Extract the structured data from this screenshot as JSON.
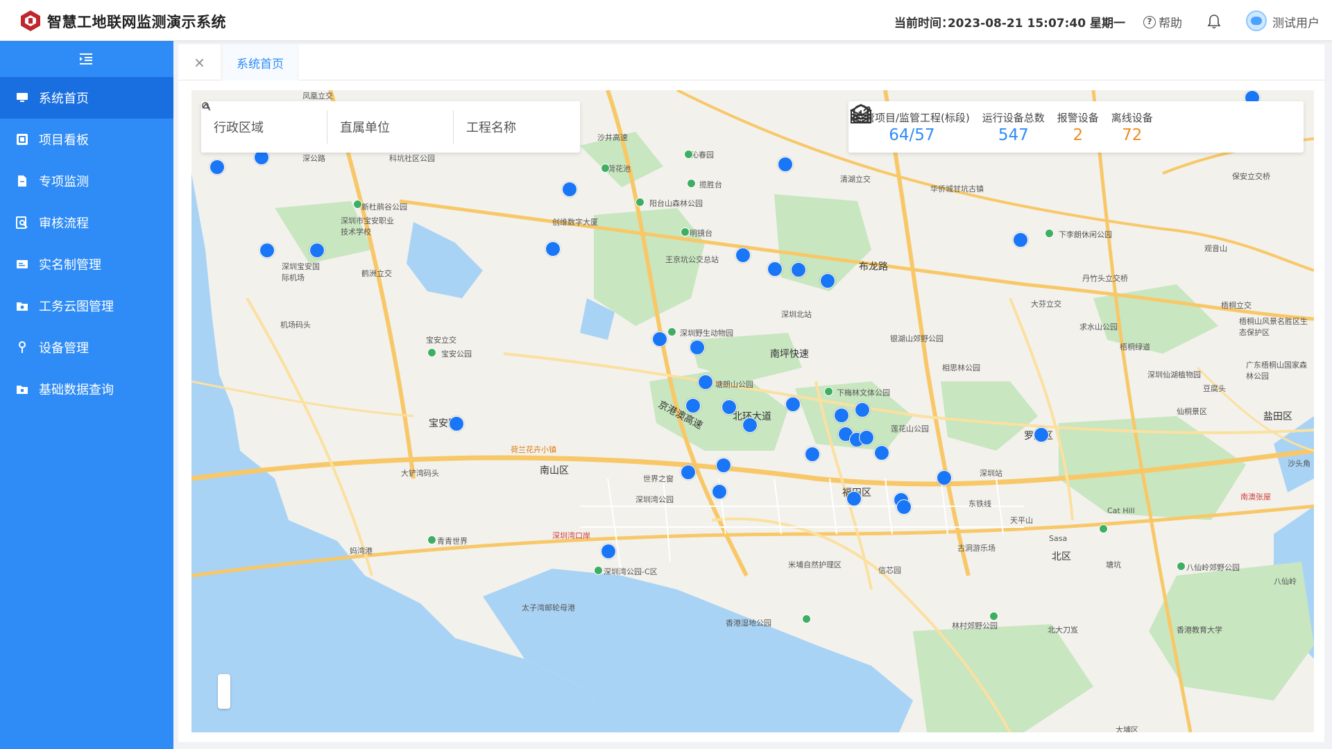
{
  "app": {
    "title": "智慧工地联网监测演示系统"
  },
  "header": {
    "time_label": "当前时间：",
    "time_value": "2023-08-21 15:07:40 星期一",
    "help_label": "帮助",
    "user_name": "测试用户"
  },
  "sidebar": {
    "items": [
      {
        "label": "系统首页",
        "icon": "monitor-icon",
        "active": true
      },
      {
        "label": "项目看板",
        "icon": "board-icon"
      },
      {
        "label": "专项监测",
        "icon": "document-icon"
      },
      {
        "label": "审核流程",
        "icon": "search-doc-icon"
      },
      {
        "label": "实名制管理",
        "icon": "id-card-icon"
      },
      {
        "label": "工务云图管理",
        "icon": "folder-icon"
      },
      {
        "label": "设备管理",
        "icon": "pin-icon"
      },
      {
        "label": "基础数据查询",
        "icon": "folder-data-icon"
      }
    ]
  },
  "tabs": [
    {
      "label": "系统首页",
      "active": true
    }
  ],
  "filters": {
    "district": "行政区域",
    "unit": "直属单位",
    "project": "工程名称"
  },
  "stats": {
    "projects": {
      "label": "监管项目/监管工程(标段)",
      "value": "64/57",
      "color": "#2f8cf6"
    },
    "devices": {
      "label": "运行设备总数",
      "value": "547",
      "color": "#2f8cf6"
    },
    "alarm": {
      "label": "报警设备",
      "value": "2",
      "color": "#f08c1e"
    },
    "offline": {
      "label": "离线设备",
      "value": "72",
      "color": "#f08c1e"
    }
  },
  "map_labels": [
    "凤凰立交",
    "深公路",
    "科坑社区公园",
    "沙井高速",
    "沁春园",
    "荷花池",
    "揽胜台",
    "阳台山森林公园",
    "清湖立交",
    "华侨城甘坑古镇",
    "下李朗休闲公园",
    "保安立交桥",
    "新杜鹃谷公园",
    "深圳市宝安职业技术学校",
    "创维数字大厦",
    "明镜台",
    "王京坑公交总站",
    "布龙路",
    "丹竹头立交桥",
    "观音山",
    "深圳宝安国际机场",
    "鹤洲立交",
    "深圳北站",
    "大芬立交",
    "梧桐立交",
    "机场码头",
    "深圳野生动物园",
    "南坪快速",
    "银湖山郊野公园",
    "求水山公园",
    "梧桐绿道",
    "梧桐山风景名胜区生态保护区",
    "宝安立交",
    "宝安公园",
    "相思林公园",
    "深圳仙湖植物园",
    "广东梧桐山国家森林公园",
    "塘朗山公园",
    "下梅林文体公园",
    "豆腐头",
    "仙桐景区",
    "盐田区",
    "宝安区",
    "京港澳高速",
    "北环大道",
    "莲花山公园",
    "罗湖区",
    "荷兰花卉小镇",
    "大铲湾码头",
    "南山区",
    "世界之窗",
    "深圳站",
    "沙头角",
    "南澳张屋",
    "深圳湾公园",
    "福田区",
    "东铁线",
    "天平山",
    "Cat Hill",
    "深圳湾口岸",
    "青青世界",
    "Sasa",
    "古洞游乐场",
    "北区",
    "塘坑",
    "八仙岭郊野公园",
    "八仙岭",
    "妈湾港",
    "米埔自然护理区",
    "信芯园",
    "深圳湾公园-C区",
    "太子湾邮轮母港",
    "香港湿地公园",
    "林村郊野公园",
    "北大刀岌",
    "香港教育大学",
    "大埔区"
  ],
  "colors": {
    "primary": "#2f8cf6",
    "sidebar_active": "#1a6fe0",
    "marker": "#1976f7",
    "warning": "#f08c1e",
    "water": "#a9d3f5",
    "park": "#c8e6c0",
    "road": "#f8c868"
  }
}
